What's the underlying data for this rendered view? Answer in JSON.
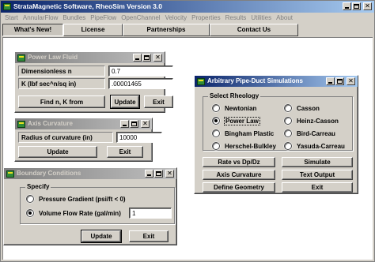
{
  "app": {
    "title": "StrataMagnetic Software, RheoSim Version 3.0"
  },
  "menu": [
    "Start",
    "AnnularFlow",
    "Bundles",
    "PipeFlow",
    "OpenChannel",
    "Velocity",
    "Properties",
    "Results",
    "Utilities",
    "About"
  ],
  "tabs": [
    "What's New!",
    "License",
    "Partnerships",
    "Contact Us"
  ],
  "power_law": {
    "title": "Power Law Fluid",
    "n_label": "Dimensionless n",
    "n_value": "0.7",
    "k_label": "K (lbf sec^n/sq in)",
    "k_value": ".00001465",
    "find_label": "Find n, K from",
    "update_label": "Update",
    "exit_label": "Exit"
  },
  "axis_curvature": {
    "title": "Axis Curvature",
    "radius_label": "Radius of curvature (in)",
    "radius_value": "10000",
    "update_label": "Update",
    "exit_label": "Exit"
  },
  "boundary": {
    "title": "Boundary Conditions",
    "group_label": "Specify",
    "options": [
      "Pressure Gradient (psi/ft < 0)",
      "Volume Flow Rate (gal/min)"
    ],
    "selected": 1,
    "flow_value": "1",
    "update_label": "Update",
    "exit_label": "Exit"
  },
  "pipe_duct": {
    "title": "Arbitrary Pipe-Duct Simulations",
    "group_label": "Select Rheology",
    "rheology_left": [
      "Newtonian",
      "Power Law",
      "Bingham Plastic",
      "Herschel-Bulkley"
    ],
    "rheology_right": [
      "Casson",
      "Heinz-Casson",
      "Bird-Carreau",
      "Yasuda-Carreau"
    ],
    "selected": "Power Law",
    "buttons": {
      "rate_vs_dpdz": "Rate vs Dp/Dz",
      "simulate": "Simulate",
      "axis_curvature": "Axis Curvature",
      "text_output": "Text Output",
      "define_geometry": "Define Geometry",
      "exit": "Exit"
    }
  },
  "colors": {
    "title_active_start": "#0a246a",
    "title_active_end": "#a6caf0",
    "title_inactive_start": "#808080",
    "face": "#d4d0c8",
    "workspace": "#ffffff"
  }
}
